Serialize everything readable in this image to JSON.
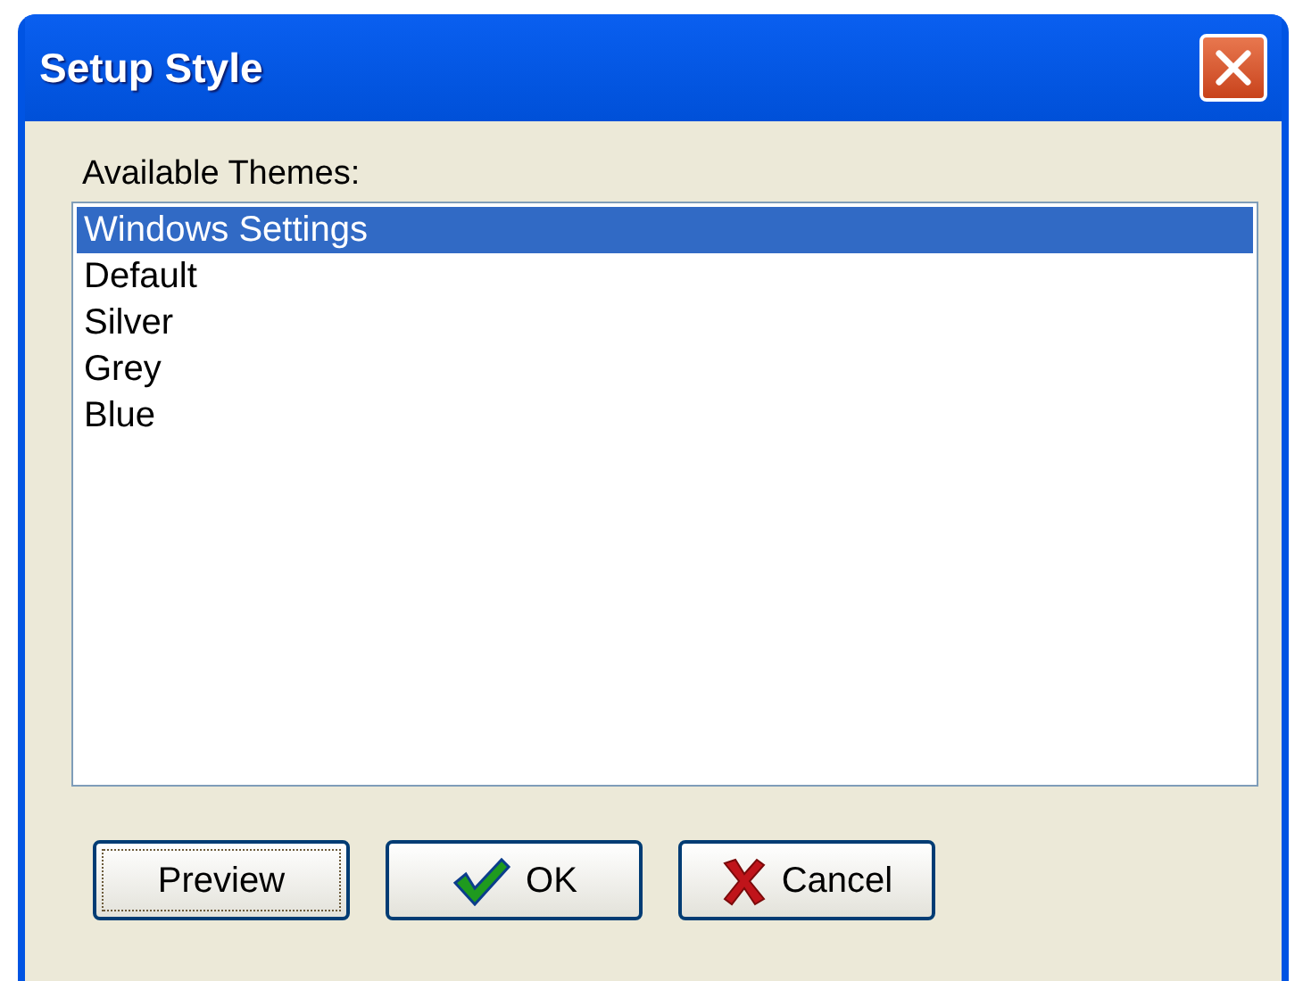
{
  "window": {
    "title": "Setup Style"
  },
  "themes_label": "Available Themes:",
  "themes": [
    {
      "label": "Windows Settings",
      "selected": true
    },
    {
      "label": "Default",
      "selected": false
    },
    {
      "label": "Silver",
      "selected": false
    },
    {
      "label": "Grey",
      "selected": false
    },
    {
      "label": "Blue",
      "selected": false
    }
  ],
  "buttons": [
    {
      "label": "Preview",
      "kind": "plain",
      "focused": true
    },
    {
      "label": "OK",
      "kind": "confirm",
      "focused": false
    },
    {
      "label": "Cancel",
      "kind": "cancel",
      "focused": false
    }
  ]
}
